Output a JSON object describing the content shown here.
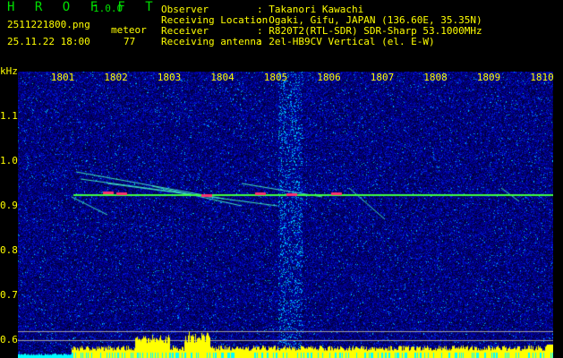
{
  "header": {
    "app_name": "H R O F F T",
    "version": "1.0.0",
    "filename": "2511221800.png",
    "datetime": "25.11.22 18:00",
    "meteor_label": "meteor",
    "meteor_count": "77"
  },
  "info": [
    {
      "label": "Observer",
      "value": ": Takanori Kawachi"
    },
    {
      "label": "Receiving Location",
      "value": ": Ogaki, Gifu, JAPAN (136.60E, 35.35N)"
    },
    {
      "label": "Receiver",
      "value": ": R820T2(RTL-SDR) SDR-Sharp 53.1000MHz"
    },
    {
      "label": "Receiving antenna",
      "value": ": 2el-HB9CV Vertical (el. E-W)"
    }
  ],
  "axis": {
    "y_unit": "kHz",
    "y_ticks": [
      "1.1",
      "1.0",
      "0.9",
      "0.8",
      "0.7",
      "0.6"
    ],
    "x_ticks": [
      "1801",
      "1802",
      "1803",
      "1804",
      "1805",
      "1806",
      "1807",
      "1808",
      "1809",
      "1810"
    ]
  },
  "colors": {
    "text": "#ffff00",
    "title": "#00e000",
    "signal": "#40ff40",
    "histogram": "#ffff00",
    "histogram_low": "#00ffff"
  }
}
